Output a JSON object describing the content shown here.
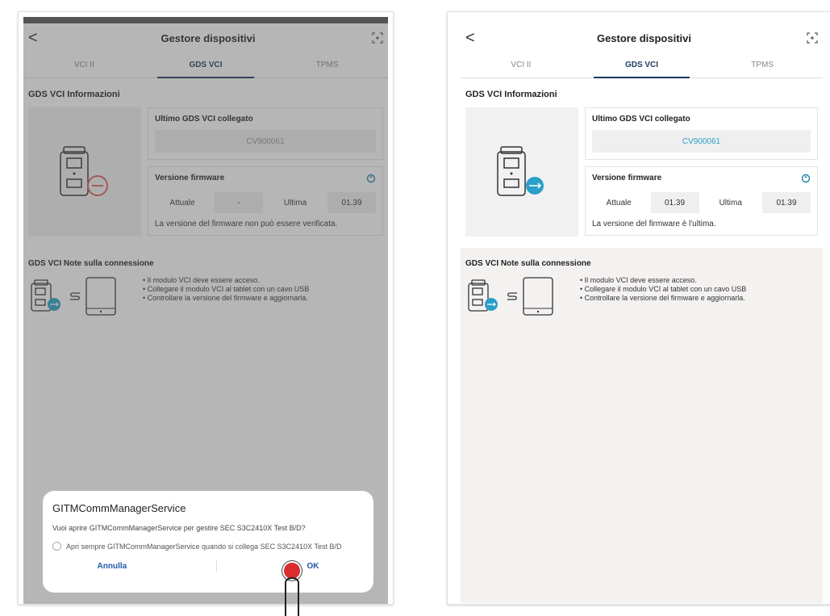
{
  "header": {
    "title": "Gestore dispositivi",
    "back_glyph": "<",
    "icons": [
      "back-icon",
      "scan-icon"
    ]
  },
  "tabs": [
    {
      "label": "VCI II"
    },
    {
      "label": "GDS VCI",
      "active": true
    },
    {
      "label": "TPMS"
    }
  ],
  "info": {
    "section_title": "GDS VCI Informazioni",
    "last_connected_label": "Ultimo GDS VCI collegato",
    "serial": "CV900061",
    "firmware_label": "Versione firmware",
    "current_label": "Attuale",
    "latest_label": "Ultima"
  },
  "left": {
    "firmware_current": "-",
    "firmware_latest": "01.39",
    "firmware_msg": "La versione del firmware non può essere verificata."
  },
  "right": {
    "firmware_current": "01.39",
    "firmware_latest": "01.39",
    "firmware_msg": "La versione del firmware è l'ultima."
  },
  "notes": {
    "title": "GDS VCI Note sulla connessione",
    "items": [
      "• Il modulo VCI deve essere acceso.",
      "• Collegare il modulo VCI al tablet con un cavo USB",
      "• Controllare la versione del firmware e aggiornarla."
    ]
  },
  "dialog": {
    "title": "GITMCommManagerService",
    "message": "Vuoi aprire GITMCommManagerService per gestire SEC S3C2410X Test B/D?",
    "checkbox_label": "Apri sempre GITMCommManagerService quando si collega SEC S3C2410X Test B/D",
    "cancel_label": "Annulla",
    "ok_label": "OK"
  },
  "colors": {
    "accent": "#1b3a5e",
    "serial_text": "#2aa0c8",
    "error_red": "#d9534f",
    "usb_blue": "#2aa0c8",
    "touch_red": "#d92c2c"
  }
}
